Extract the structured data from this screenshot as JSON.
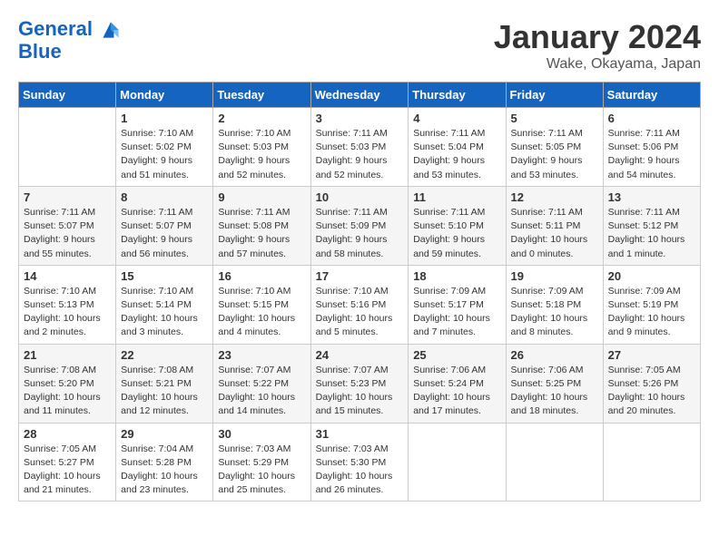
{
  "logo": {
    "line1": "General",
    "line2": "Blue"
  },
  "title": "January 2024",
  "location": "Wake, Okayama, Japan",
  "weekdays": [
    "Sunday",
    "Monday",
    "Tuesday",
    "Wednesday",
    "Thursday",
    "Friday",
    "Saturday"
  ],
  "weeks": [
    [
      {
        "day": "",
        "sunrise": "",
        "sunset": "",
        "daylight": ""
      },
      {
        "day": "1",
        "sunrise": "Sunrise: 7:10 AM",
        "sunset": "Sunset: 5:02 PM",
        "daylight": "Daylight: 9 hours and 51 minutes."
      },
      {
        "day": "2",
        "sunrise": "Sunrise: 7:10 AM",
        "sunset": "Sunset: 5:03 PM",
        "daylight": "Daylight: 9 hours and 52 minutes."
      },
      {
        "day": "3",
        "sunrise": "Sunrise: 7:11 AM",
        "sunset": "Sunset: 5:03 PM",
        "daylight": "Daylight: 9 hours and 52 minutes."
      },
      {
        "day": "4",
        "sunrise": "Sunrise: 7:11 AM",
        "sunset": "Sunset: 5:04 PM",
        "daylight": "Daylight: 9 hours and 53 minutes."
      },
      {
        "day": "5",
        "sunrise": "Sunrise: 7:11 AM",
        "sunset": "Sunset: 5:05 PM",
        "daylight": "Daylight: 9 hours and 53 minutes."
      },
      {
        "day": "6",
        "sunrise": "Sunrise: 7:11 AM",
        "sunset": "Sunset: 5:06 PM",
        "daylight": "Daylight: 9 hours and 54 minutes."
      }
    ],
    [
      {
        "day": "7",
        "sunrise": "Sunrise: 7:11 AM",
        "sunset": "Sunset: 5:07 PM",
        "daylight": "Daylight: 9 hours and 55 minutes."
      },
      {
        "day": "8",
        "sunrise": "Sunrise: 7:11 AM",
        "sunset": "Sunset: 5:07 PM",
        "daylight": "Daylight: 9 hours and 56 minutes."
      },
      {
        "day": "9",
        "sunrise": "Sunrise: 7:11 AM",
        "sunset": "Sunset: 5:08 PM",
        "daylight": "Daylight: 9 hours and 57 minutes."
      },
      {
        "day": "10",
        "sunrise": "Sunrise: 7:11 AM",
        "sunset": "Sunset: 5:09 PM",
        "daylight": "Daylight: 9 hours and 58 minutes."
      },
      {
        "day": "11",
        "sunrise": "Sunrise: 7:11 AM",
        "sunset": "Sunset: 5:10 PM",
        "daylight": "Daylight: 9 hours and 59 minutes."
      },
      {
        "day": "12",
        "sunrise": "Sunrise: 7:11 AM",
        "sunset": "Sunset: 5:11 PM",
        "daylight": "Daylight: 10 hours and 0 minutes."
      },
      {
        "day": "13",
        "sunrise": "Sunrise: 7:11 AM",
        "sunset": "Sunset: 5:12 PM",
        "daylight": "Daylight: 10 hours and 1 minute."
      }
    ],
    [
      {
        "day": "14",
        "sunrise": "Sunrise: 7:10 AM",
        "sunset": "Sunset: 5:13 PM",
        "daylight": "Daylight: 10 hours and 2 minutes."
      },
      {
        "day": "15",
        "sunrise": "Sunrise: 7:10 AM",
        "sunset": "Sunset: 5:14 PM",
        "daylight": "Daylight: 10 hours and 3 minutes."
      },
      {
        "day": "16",
        "sunrise": "Sunrise: 7:10 AM",
        "sunset": "Sunset: 5:15 PM",
        "daylight": "Daylight: 10 hours and 4 minutes."
      },
      {
        "day": "17",
        "sunrise": "Sunrise: 7:10 AM",
        "sunset": "Sunset: 5:16 PM",
        "daylight": "Daylight: 10 hours and 5 minutes."
      },
      {
        "day": "18",
        "sunrise": "Sunrise: 7:09 AM",
        "sunset": "Sunset: 5:17 PM",
        "daylight": "Daylight: 10 hours and 7 minutes."
      },
      {
        "day": "19",
        "sunrise": "Sunrise: 7:09 AM",
        "sunset": "Sunset: 5:18 PM",
        "daylight": "Daylight: 10 hours and 8 minutes."
      },
      {
        "day": "20",
        "sunrise": "Sunrise: 7:09 AM",
        "sunset": "Sunset: 5:19 PM",
        "daylight": "Daylight: 10 hours and 9 minutes."
      }
    ],
    [
      {
        "day": "21",
        "sunrise": "Sunrise: 7:08 AM",
        "sunset": "Sunset: 5:20 PM",
        "daylight": "Daylight: 10 hours and 11 minutes."
      },
      {
        "day": "22",
        "sunrise": "Sunrise: 7:08 AM",
        "sunset": "Sunset: 5:21 PM",
        "daylight": "Daylight: 10 hours and 12 minutes."
      },
      {
        "day": "23",
        "sunrise": "Sunrise: 7:07 AM",
        "sunset": "Sunset: 5:22 PM",
        "daylight": "Daylight: 10 hours and 14 minutes."
      },
      {
        "day": "24",
        "sunrise": "Sunrise: 7:07 AM",
        "sunset": "Sunset: 5:23 PM",
        "daylight": "Daylight: 10 hours and 15 minutes."
      },
      {
        "day": "25",
        "sunrise": "Sunrise: 7:06 AM",
        "sunset": "Sunset: 5:24 PM",
        "daylight": "Daylight: 10 hours and 17 minutes."
      },
      {
        "day": "26",
        "sunrise": "Sunrise: 7:06 AM",
        "sunset": "Sunset: 5:25 PM",
        "daylight": "Daylight: 10 hours and 18 minutes."
      },
      {
        "day": "27",
        "sunrise": "Sunrise: 7:05 AM",
        "sunset": "Sunset: 5:26 PM",
        "daylight": "Daylight: 10 hours and 20 minutes."
      }
    ],
    [
      {
        "day": "28",
        "sunrise": "Sunrise: 7:05 AM",
        "sunset": "Sunset: 5:27 PM",
        "daylight": "Daylight: 10 hours and 21 minutes."
      },
      {
        "day": "29",
        "sunrise": "Sunrise: 7:04 AM",
        "sunset": "Sunset: 5:28 PM",
        "daylight": "Daylight: 10 hours and 23 minutes."
      },
      {
        "day": "30",
        "sunrise": "Sunrise: 7:03 AM",
        "sunset": "Sunset: 5:29 PM",
        "daylight": "Daylight: 10 hours and 25 minutes."
      },
      {
        "day": "31",
        "sunrise": "Sunrise: 7:03 AM",
        "sunset": "Sunset: 5:30 PM",
        "daylight": "Daylight: 10 hours and 26 minutes."
      },
      {
        "day": "",
        "sunrise": "",
        "sunset": "",
        "daylight": ""
      },
      {
        "day": "",
        "sunrise": "",
        "sunset": "",
        "daylight": ""
      },
      {
        "day": "",
        "sunrise": "",
        "sunset": "",
        "daylight": ""
      }
    ]
  ]
}
